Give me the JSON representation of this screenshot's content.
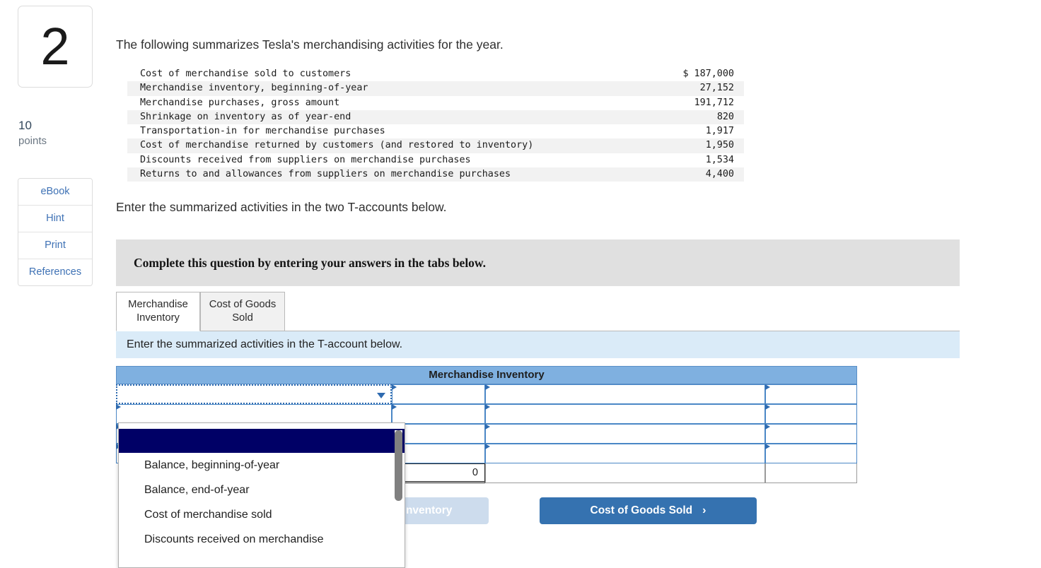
{
  "left_rail": {
    "question_number": "2",
    "points_value": "10",
    "points_label": "points",
    "buttons": [
      {
        "label": "eBook",
        "name": "ebook"
      },
      {
        "label": "Hint",
        "name": "hint"
      },
      {
        "label": "Print",
        "name": "print"
      },
      {
        "label": "References",
        "name": "references"
      }
    ]
  },
  "question": {
    "lead_text": "The following summarizes Tesla's merchandising activities for the year.",
    "sub_text": "Enter the summarized activities in the two T-accounts below.",
    "banner_text": "Complete this question by entering your answers in the tabs below.",
    "tab_instruction": "Enter the summarized activities in the T-account below."
  },
  "facts_table": {
    "rows": [
      {
        "label": "Cost of merchandise sold to customers",
        "amount": "$ 187,000"
      },
      {
        "label": "Merchandise inventory, beginning-of-year",
        "amount": "27,152"
      },
      {
        "label": "Merchandise purchases, gross amount",
        "amount": "191,712"
      },
      {
        "label": "Shrinkage on inventory as of year-end",
        "amount": "820"
      },
      {
        "label": "Transportation-in for merchandise purchases",
        "amount": "1,917"
      },
      {
        "label": "Cost of merchandise returned by customers (and restored to inventory)",
        "amount": "1,950"
      },
      {
        "label": "Discounts received from suppliers on merchandise purchases",
        "amount": "1,534"
      },
      {
        "label": "Returns to and allowances from suppliers on merchandise purchases",
        "amount": "4,400"
      }
    ]
  },
  "tabs": [
    {
      "label": "Merchandise Inventory",
      "active": true
    },
    {
      "label": "Cost of Goods Sold",
      "active": false
    }
  ],
  "t_account": {
    "title": "Merchandise Inventory",
    "debit_total": "0",
    "rows": [
      {
        "description": "",
        "debit": "",
        "credit_description": "",
        "credit": ""
      },
      {
        "description": "",
        "debit": "",
        "credit_description": "",
        "credit": ""
      },
      {
        "description": "",
        "debit": "",
        "credit_description": "",
        "credit": ""
      },
      {
        "description": "",
        "debit": "",
        "credit_description": "",
        "credit": ""
      }
    ]
  },
  "dropdown": {
    "open": true,
    "selected_value": "",
    "options": [
      "",
      "Balance, beginning-of-year",
      "Balance, end-of-year",
      "Cost of merchandise sold",
      "Discounts received on merchandise"
    ]
  },
  "nav": {
    "prev_label": "Merchandise Inventory",
    "next_label": "Cost of Goods Sold",
    "next_chevron": "›"
  },
  "colors": {
    "accent_blue": "#3572b0",
    "header_blue": "#7fb0e0",
    "instruction_blue": "#daebf8",
    "banner_gray": "#e0e0e0",
    "dropdown_navy": "#000066",
    "link_blue": "#3f72b5"
  }
}
